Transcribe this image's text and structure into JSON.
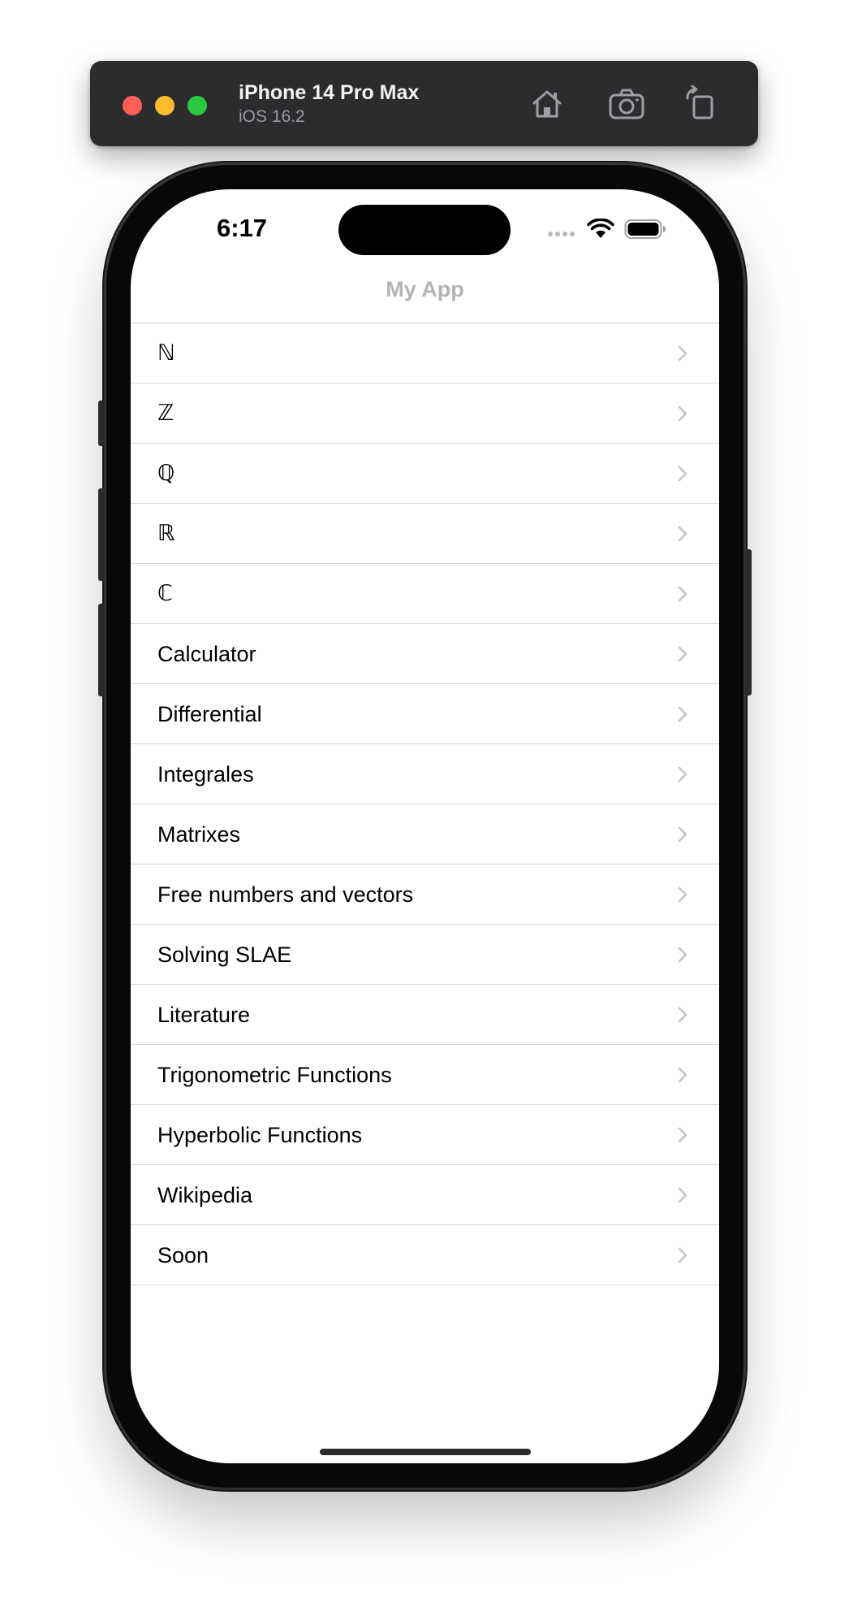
{
  "simulator": {
    "device_name": "iPhone 14 Pro Max",
    "os_version": "iOS 16.2",
    "buttons": [
      "home-icon",
      "screenshot-icon",
      "rotate-icon"
    ]
  },
  "status_bar": {
    "time": "6:17"
  },
  "nav": {
    "title": "My App"
  },
  "list": {
    "items": [
      {
        "label": "ℕ"
      },
      {
        "label": "ℤ"
      },
      {
        "label": "ℚ"
      },
      {
        "label": "ℝ"
      },
      {
        "label": "ℂ"
      },
      {
        "label": "Calculator"
      },
      {
        "label": "Differential"
      },
      {
        "label": "Integrales"
      },
      {
        "label": "Matrixes"
      },
      {
        "label": "Free numbers and vectors"
      },
      {
        "label": "Solving SLAE"
      },
      {
        "label": "Literature"
      },
      {
        "label": "Trigonometric Functions"
      },
      {
        "label": "Hyperbolic Functions"
      },
      {
        "label": "Wikipedia"
      },
      {
        "label": "Soon"
      }
    ]
  },
  "colors": {
    "titlebar": "#2c2c2e",
    "nav_title": "#b4b4b8",
    "separator": "#d6d6da",
    "chevron": "#c4c4c8"
  }
}
